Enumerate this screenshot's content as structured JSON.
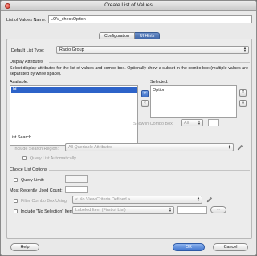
{
  "window": {
    "title": "Create List of Values"
  },
  "name_field": {
    "label": "List of Values Name:",
    "value": "LOV_checkOption"
  },
  "tabs": [
    {
      "label": "Configuration"
    },
    {
      "label": "UI Hints"
    }
  ],
  "default_list_type": {
    "label": "Default List Type:",
    "value": "Radio Group"
  },
  "display_attributes": {
    "title": "Display Attributes",
    "description": "Select display attributes for the list of values and combo box. Optionally show a subset in the combo box (multiple values are separated by white space).",
    "available_label": "Available:",
    "available_items": [
      "Id"
    ],
    "selected_label": "Selected:",
    "selected_items": [
      "Option"
    ],
    "show_in_combo_label": "Show in Combo Box:",
    "show_in_combo_value": "All"
  },
  "list_search": {
    "title": "List Search",
    "include_search_region_label": "Include Search Region:",
    "include_search_region_value": "All Queriable Attributes",
    "query_automatically_label": "Query List Automatically"
  },
  "choice_list_options": {
    "title": "Choice List Options",
    "query_limit_label": "Query Limit:",
    "most_recently_used_label": "Most Recently Used Count:",
    "filter_combo_label": "Filter Combo Box Using",
    "filter_combo_value": "< No View Criteria Defined >",
    "include_no_selection_label": "Include \"No Selection\" Item:",
    "include_no_selection_value": "Labeled Item (First of List)",
    "ellipsis_label": "..."
  },
  "footer": {
    "help": "Help",
    "ok": "OK",
    "cancel": "Cancel"
  }
}
